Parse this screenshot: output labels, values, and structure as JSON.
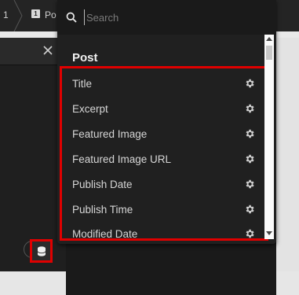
{
  "breadcrumb": {
    "item1": "1",
    "item2_badge": "1",
    "item2": "Po"
  },
  "search": {
    "placeholder": "Search",
    "value": ""
  },
  "group": {
    "title": "Post"
  },
  "items": [
    {
      "label": "Title",
      "icon": "gear-icon"
    },
    {
      "label": "Excerpt",
      "icon": "gear-icon"
    },
    {
      "label": "Featured Image",
      "icon": "gear-icon"
    },
    {
      "label": "Featured Image URL",
      "icon": "gear-icon"
    },
    {
      "label": "Publish Date",
      "icon": "gear-icon"
    },
    {
      "label": "Publish Time",
      "icon": "gear-icon"
    },
    {
      "label": "Modified Date",
      "icon": "gear-icon"
    }
  ],
  "colors": {
    "highlight": "#e00000",
    "panel": "#202020",
    "text": "#d6d6d6"
  }
}
